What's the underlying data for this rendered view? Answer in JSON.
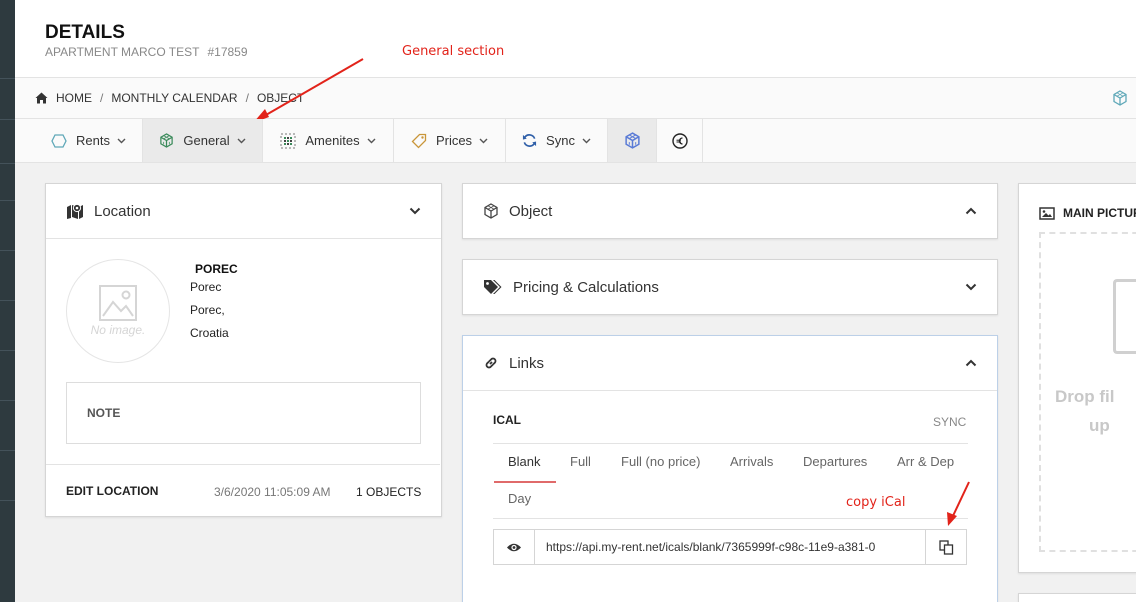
{
  "header": {
    "title": "DETAILS",
    "subtitle": "APARTMENT MARCO TEST",
    "object_id": "#17859"
  },
  "annotations": {
    "general": "General section",
    "ical": "copy iCal"
  },
  "breadcrumb": {
    "items": [
      "HOME",
      "MONTHLY CALENDAR",
      "OBJECT"
    ],
    "separator": "/"
  },
  "tabs": [
    {
      "label": "Rents",
      "icon": "hexagon-icon"
    },
    {
      "label": "General",
      "icon": "cube-icon",
      "active": true
    },
    {
      "label": "Amenites",
      "icon": "grid-dots-icon"
    },
    {
      "label": "Prices",
      "icon": "tag-icon"
    },
    {
      "label": "Sync",
      "icon": "sync-icon"
    },
    {
      "label": "",
      "icon": "cube-icon"
    },
    {
      "label": "",
      "icon": "euro-icon"
    }
  ],
  "location": {
    "title": "Location",
    "no_image": "No image.",
    "name": "POREC",
    "lines": [
      "Porec",
      "Porec,",
      "Croatia"
    ],
    "note_label": "NOTE",
    "edit_label": "EDIT LOCATION",
    "updated": "3/6/2020 11:05:09 AM",
    "objects_count": "1 OBJECTS"
  },
  "object_panel": {
    "title": "Object"
  },
  "pricing_panel": {
    "title": "Pricing & Calculations"
  },
  "links": {
    "title": "Links",
    "ical_label": "ICAL",
    "sync_label": "SYNC",
    "tabs": [
      "Blank",
      "Full",
      "Full (no price)",
      "Arrivals",
      "Departures",
      "Arr & Dep",
      "Day"
    ],
    "active_tab": "Blank",
    "url": "https://api.my-rent.net/icals/blank/7365999f-c98c-11e9-a381-0"
  },
  "main_picture": {
    "title": "MAIN PICTUR",
    "drop_text_1": "Drop fil",
    "drop_text_2": "up"
  },
  "colors": {
    "accent_red": "#e2231a",
    "tab_underline": "#e06a6a",
    "sidebar": "#2e3a3f",
    "icon_blue": "#5a7bd6"
  }
}
